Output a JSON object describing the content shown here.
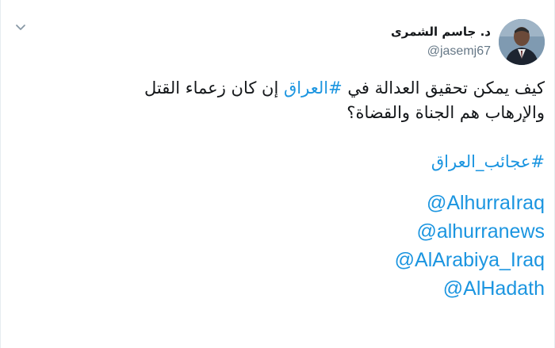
{
  "author": {
    "display_name": "د. جاسم الشمرى",
    "handle": "@jasemj67"
  },
  "tweet": {
    "line1_pre": "كيف يمكن تحقيق العدالة في",
    "line1_hashtag": "#العراق",
    "line1_post": "إن كان زعماء القتل",
    "line2": "والإرهاب هم الجناة والقضاة؟",
    "hashtag2": "#عجائب_العراق",
    "mentions": [
      "@AlhurraIraq",
      "@alhurranews",
      "@AlArabiya_Iraq",
      "@AlHadath"
    ]
  },
  "colors": {
    "link": "#1b95e0",
    "text": "#14171a",
    "secondary": "#657786"
  },
  "icons": {
    "menu": "chevron-down-icon"
  }
}
